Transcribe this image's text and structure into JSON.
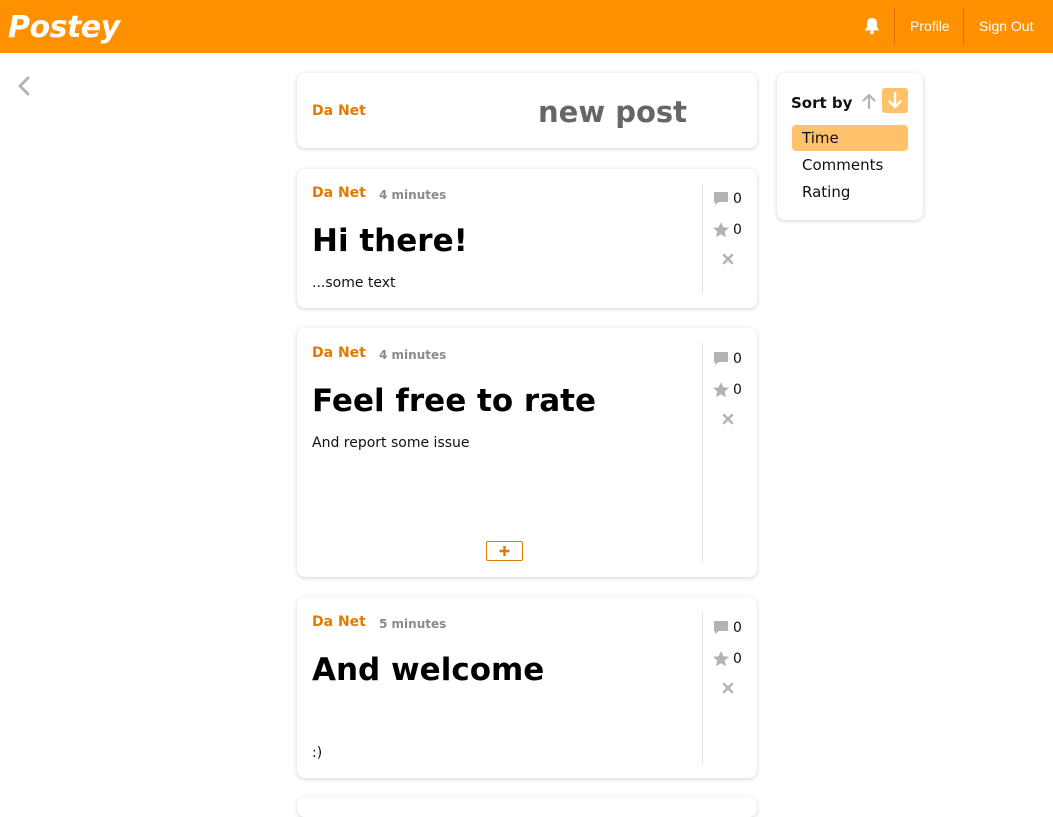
{
  "app": {
    "brand": "Postey"
  },
  "nav": {
    "profile": "Profile",
    "sign_out": "Sign Out"
  },
  "new_post": {
    "author": "Da Net",
    "label": "new post"
  },
  "posts": [
    {
      "author": "Da Net",
      "time": "4 minutes",
      "title": "Hi there!",
      "body": "...some text",
      "comments": "0",
      "rating": "0"
    },
    {
      "author": "Da Net",
      "time": "4 minutes",
      "title": "Feel free to rate",
      "body": "And report some issue",
      "comments": "0",
      "rating": "0"
    },
    {
      "author": "Da Net",
      "time": "5 minutes",
      "title": "And welcome",
      "body": ":)",
      "comments": "0",
      "rating": "0"
    }
  ],
  "sort": {
    "label": "Sort by",
    "options": [
      "Time",
      "Comments",
      "Rating"
    ],
    "selected": "Time",
    "direction": "descending"
  },
  "colors": {
    "accent": "#ff9100",
    "author": "#e07b00",
    "highlight": "#ffc26a"
  },
  "icons": [
    "bell-icon",
    "chevron-left-icon",
    "comment-icon",
    "star-icon",
    "close-icon",
    "plus-icon",
    "arrow-up-icon",
    "arrow-down-icon"
  ]
}
